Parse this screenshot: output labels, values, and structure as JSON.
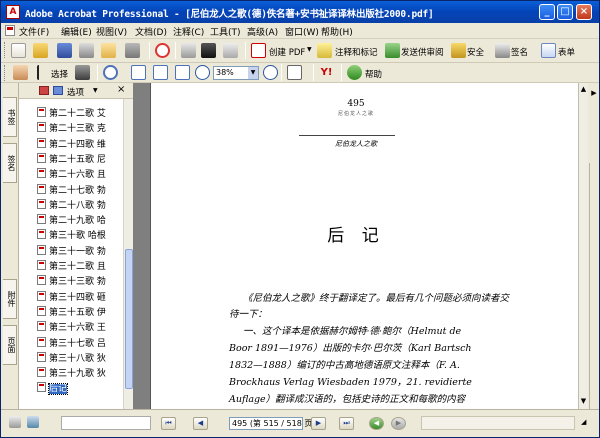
{
  "window": {
    "title": "Adobe Acrobat Professional - [尼伯龙人之歌(德)佚名著+安书祉译译林出版社2000.pdf]",
    "app_icon": "A",
    "min": "_",
    "max": "□",
    "close": "×"
  },
  "menu": [
    "文件(F)",
    "编辑(E)",
    "视图(V)",
    "文档(D)",
    "注释(C)",
    "工具(T)",
    "高级(A)",
    "窗口(W)",
    "帮助(H)"
  ],
  "toolbar1": {
    "create_pdf": "创建 PDF",
    "comment_markup": "注释和标记",
    "send_review": "发送供审阅",
    "secure": "安全",
    "sign": "签名",
    "forms": "表单"
  },
  "toolbar2": {
    "select": "选择",
    "zoom": "38%",
    "help": "帮助"
  },
  "bookmarks": {
    "options_label": "选项",
    "close": "×",
    "items": [
      "第二十二歌 艾",
      "第二十三歌 克",
      "第二十四歌 维",
      "第二十五歌 尼",
      "第二十六歌 且",
      "第二十七歌 勃",
      "第二十八歌 勃",
      "第二十九歌 哈",
      "第三十歌 哈根",
      "第三十一歌 勃",
      "第三十二歌 且",
      "第三十三歌 勃",
      "第三十四歌 砸",
      "第三十五歌 伊",
      "第三十六歌 王",
      "第三十七歌 吕",
      "第三十八歌 狄",
      "第三十九歌 狄",
      "后记"
    ],
    "selected_index": 18
  },
  "left_tabs": [
    "书签",
    "签名",
    "附件",
    "页面"
  ],
  "page": {
    "page_number": "495",
    "header_small": "尼伯龙人之歌",
    "running_head": "尼伯龙人之歌",
    "heading": "后  记",
    "para1": "《尼伯龙人之歌》终于翻译定了。最后有几个问题必须向读者交待一下：",
    "para2_lines": [
      "一、这个译本是依据赫尔姆特·德·鲍尔（Helmut de",
      "Boor 1891—1976）出版的卡尔·巴尔茨（Karl Bartsch",
      "1832—1888）编订的中古高地德语原文注释本（F. A.",
      "Brockhaus Verlag Wiesbaden 1979，21. revidierte",
      "Auflage）翻译成汉语的，包括史诗的正文和每歌的内容"
    ]
  },
  "status": {
    "page_box": "495 (第 515 / 518 页)"
  }
}
